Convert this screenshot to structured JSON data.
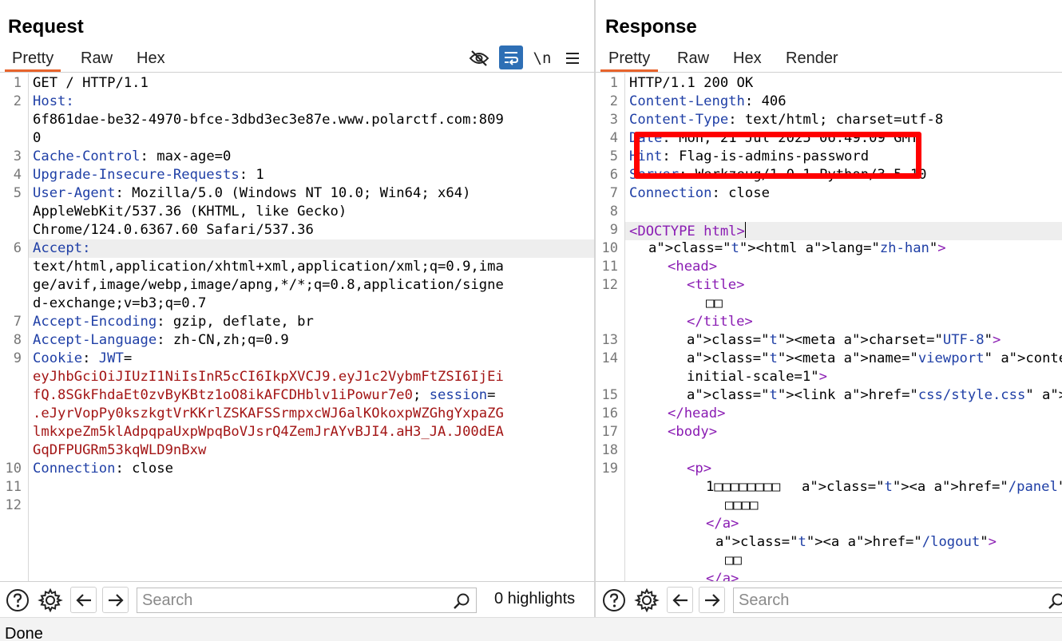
{
  "request": {
    "title": "Request",
    "tabs": [
      "Pretty",
      "Raw",
      "Hex"
    ],
    "toolbar_icons": [
      "eye-slash-icon",
      "wrap-lines-icon",
      "newline-icon",
      "menu-icon"
    ],
    "newline_label": "\\n",
    "line_numbers": [
      "1",
      "2",
      "3",
      "4",
      "5",
      "6",
      "7",
      "8",
      "9",
      "10",
      "11",
      "12"
    ],
    "lines": [
      "GET / HTTP/1.1",
      "Host:",
      "6f861dae-be32-4970-bfce-3dbd3ec3e87e.www.polarctf.com:809",
      "0",
      "Cache-Control: max-age=0",
      "Upgrade-Insecure-Requests: 1",
      "User-Agent: Mozilla/5.0 (Windows NT 10.0; Win64; x64)",
      "AppleWebKit/537.36 (KHTML, like Gecko)",
      "Chrome/124.0.6367.60 Safari/537.36",
      "Accept:",
      "text/html,application/xhtml+xml,application/xml;q=0.9,ima",
      "ge/avif,image/webp,image/apng,*/*;q=0.8,application/signe",
      "d-exchange;v=b3;q=0.7",
      "Accept-Encoding: gzip, deflate, br",
      "Accept-Language: zh-CN,zh;q=0.9",
      "Cookie: JWT=",
      "eyJhbGciOiJIUzI1NiIsInR5cCI6IkpXVCJ9.eyJ1c2VybmFtZSI6IjEi",
      "fQ.8SGkFhdaEt0zvByKBtz1oO8ikAFCDHblv1iPowur7e0; session=",
      ".eJyrVopPy0kszkgtVrKKrlZSKAFSSrmpxcWJ6alKOkoxpWZGhgYxpaZG",
      "lmkxpeZm5klAdpqpaUxpWpqBoVJsrQ4ZemJrAYvBJI4.aH3_JA.J00dEA",
      "GqDFPUGRm53kqWLD9nBxw",
      "Connection: close"
    ],
    "search_placeholder": "Search",
    "highlights": "0 highlights"
  },
  "response": {
    "title": "Response",
    "tabs": [
      "Pretty",
      "Raw",
      "Hex",
      "Render"
    ],
    "line_numbers": [
      "1",
      "2",
      "3",
      "4",
      "5",
      "6",
      "7",
      "8",
      "9",
      "10",
      "11",
      "12",
      "13",
      "14",
      "15",
      "16",
      "17",
      "18",
      "19"
    ],
    "lines": [
      "HTTP/1.1 200 OK",
      "Content-Length: 406",
      "Content-Type: text/html; charset=utf-8",
      "Date: Mon, 21 Jul 2025 06:49:09 GMT",
      "Hint: Flag-is-admins-password",
      "Server: Werkzeug/1.0.1 Python/3.5.10",
      "Connection: close",
      "<DOCTYPE html>",
      "<html lang=\"zh-han\">",
      "<head>",
      "<title>",
      "□□",
      "</title>",
      "<meta charset=\"UTF-8\">",
      "<meta name=\"viewport\" content=\"width=de",
      "initial-scale=1\">",
      "<link href=\"css/style.css\" rel=\"stylesh",
      "</head>",
      "<body>",
      "<p>",
      "1□□□□□□□□",
      "<a href=\"/panel\">",
      "□□□□",
      "</a>",
      "<a href=\"/logout\">",
      "□□",
      "</a>"
    ],
    "search_placeholder": "Search"
  },
  "status": "Done",
  "colors": {
    "accent_tab": "#e8642c",
    "highlight_box": "#ff0000",
    "toggle_on": "#2e6fb5"
  }
}
